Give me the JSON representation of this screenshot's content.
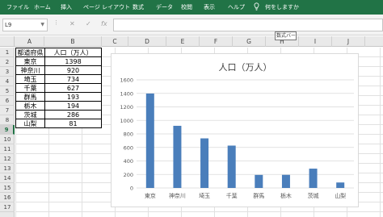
{
  "ribbon": {
    "tabs": [
      "ファイル",
      "ホーム",
      "挿入",
      "ページ レイアウト",
      "数式",
      "データ",
      "校閲",
      "表示",
      "ヘルプ"
    ],
    "tell_me": "何をしますか"
  },
  "formula_bar": {
    "name_box": "L9",
    "cancel_label": "✕",
    "enter_label": "✓",
    "fx_label": "fx",
    "formula": ""
  },
  "tooltip": "数式バー",
  "columns": [
    "A",
    "B",
    "C",
    "D",
    "E",
    "F",
    "G",
    "H",
    "I",
    "J"
  ],
  "rows": [
    "1",
    "2",
    "3",
    "4",
    "5",
    "6",
    "7",
    "8",
    "9",
    "10",
    "11",
    "12",
    "13",
    "14",
    "15",
    "16",
    "17"
  ],
  "selected_row": "9",
  "table": {
    "headers": [
      "都道府県",
      "人口（万人）"
    ],
    "rows": [
      [
        "東京",
        "1398"
      ],
      [
        "神奈川",
        "920"
      ],
      [
        "埼玉",
        "734"
      ],
      [
        "千葉",
        "627"
      ],
      [
        "群馬",
        "193"
      ],
      [
        "栃木",
        "194"
      ],
      [
        "茨城",
        "286"
      ],
      [
        "山梨",
        "81"
      ]
    ]
  },
  "chart_data": {
    "type": "bar",
    "title": "人口（万人）",
    "categories": [
      "東京",
      "神奈川",
      "埼玉",
      "千葉",
      "群馬",
      "栃木",
      "茨城",
      "山梨"
    ],
    "values": [
      1398,
      920,
      734,
      627,
      193,
      194,
      286,
      81
    ],
    "ylim": [
      0,
      1600
    ],
    "yticks": [
      "0",
      "200",
      "400",
      "600",
      "800",
      "1000",
      "1200",
      "1400",
      "1600"
    ],
    "grid": true,
    "bar_color": "#4a7ebb",
    "gridline_color": "#d9d9d9"
  },
  "colors": {
    "ribbon": "#217346",
    "selection": "#217346"
  }
}
